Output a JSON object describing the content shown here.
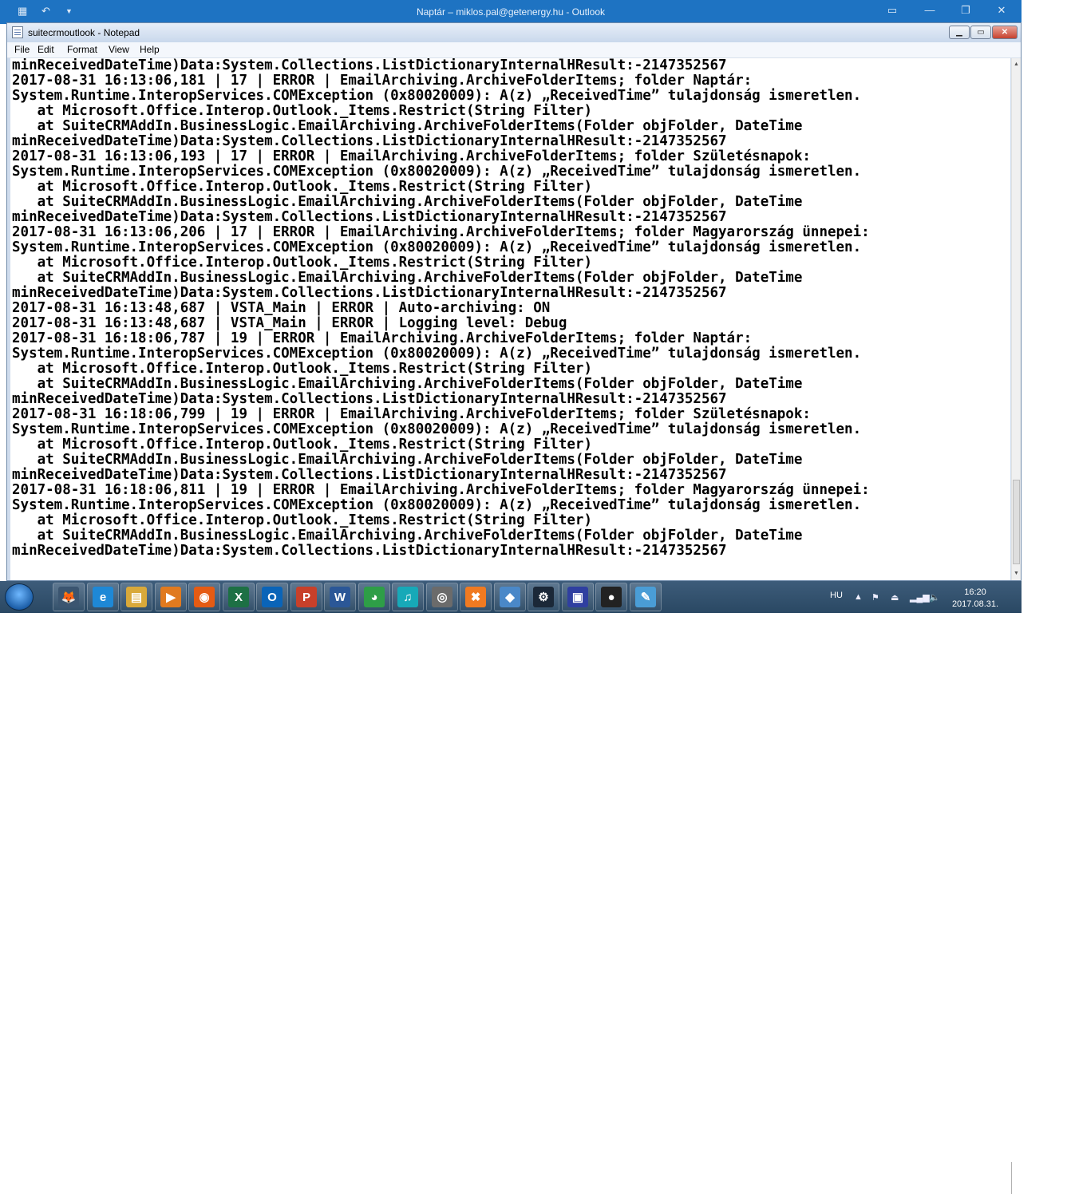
{
  "outlook": {
    "title": "Naptár – miklos.pal@getenergy.hu  -  Outlook"
  },
  "notepad": {
    "title": "suitecrmoutlook - Notepad",
    "menu": [
      "File",
      "Edit",
      "Format",
      "View",
      "Help"
    ],
    "lines": [
      "minReceivedDateTime)Data:System.Collections.ListDictionaryInternalHResult:-2147352567",
      "2017-08-31 16:13:06,181 | 17 | ERROR | EmailArchiving.ArchiveFolderItems; folder Naptár:",
      "System.Runtime.InteropServices.COMException (0x80020009): A(z) „ReceivedTime” tulajdonság ismeretlen.",
      "   at Microsoft.Office.Interop.Outlook._Items.Restrict(String Filter)",
      "   at SuiteCRMAddIn.BusinessLogic.EmailArchiving.ArchiveFolderItems(Folder objFolder, DateTime",
      "minReceivedDateTime)Data:System.Collections.ListDictionaryInternalHResult:-2147352567",
      "2017-08-31 16:13:06,193 | 17 | ERROR | EmailArchiving.ArchiveFolderItems; folder Születésnapok:",
      "System.Runtime.InteropServices.COMException (0x80020009): A(z) „ReceivedTime” tulajdonság ismeretlen.",
      "   at Microsoft.Office.Interop.Outlook._Items.Restrict(String Filter)",
      "   at SuiteCRMAddIn.BusinessLogic.EmailArchiving.ArchiveFolderItems(Folder objFolder, DateTime",
      "minReceivedDateTime)Data:System.Collections.ListDictionaryInternalHResult:-2147352567",
      "2017-08-31 16:13:06,206 | 17 | ERROR | EmailArchiving.ArchiveFolderItems; folder Magyarország ünnepei:",
      "System.Runtime.InteropServices.COMException (0x80020009): A(z) „ReceivedTime” tulajdonság ismeretlen.",
      "   at Microsoft.Office.Interop.Outlook._Items.Restrict(String Filter)",
      "   at SuiteCRMAddIn.BusinessLogic.EmailArchiving.ArchiveFolderItems(Folder objFolder, DateTime",
      "minReceivedDateTime)Data:System.Collections.ListDictionaryInternalHResult:-2147352567",
      "2017-08-31 16:13:48,687 | VSTA_Main | ERROR | Auto-archiving: ON",
      "2017-08-31 16:13:48,687 | VSTA_Main | ERROR | Logging level: Debug",
      "2017-08-31 16:18:06,787 | 19 | ERROR | EmailArchiving.ArchiveFolderItems; folder Naptár:",
      "System.Runtime.InteropServices.COMException (0x80020009): A(z) „ReceivedTime” tulajdonság ismeretlen.",
      "   at Microsoft.Office.Interop.Outlook._Items.Restrict(String Filter)",
      "   at SuiteCRMAddIn.BusinessLogic.EmailArchiving.ArchiveFolderItems(Folder objFolder, DateTime",
      "minReceivedDateTime)Data:System.Collections.ListDictionaryInternalHResult:-2147352567",
      "2017-08-31 16:18:06,799 | 19 | ERROR | EmailArchiving.ArchiveFolderItems; folder Születésnapok:",
      "System.Runtime.InteropServices.COMException (0x80020009): A(z) „ReceivedTime” tulajdonság ismeretlen.",
      "   at Microsoft.Office.Interop.Outlook._Items.Restrict(String Filter)",
      "   at SuiteCRMAddIn.BusinessLogic.EmailArchiving.ArchiveFolderItems(Folder objFolder, DateTime",
      "minReceivedDateTime)Data:System.Collections.ListDictionaryInternalHResult:-2147352567",
      "2017-08-31 16:18:06,811 | 19 | ERROR | EmailArchiving.ArchiveFolderItems; folder Magyarország ünnepei:",
      "System.Runtime.InteropServices.COMException (0x80020009): A(z) „ReceivedTime” tulajdonság ismeretlen.",
      "   at Microsoft.Office.Interop.Outlook._Items.Restrict(String Filter)",
      "   at SuiteCRMAddIn.BusinessLogic.EmailArchiving.ArchiveFolderItems(Folder objFolder, DateTime",
      "minReceivedDateTime)Data:System.Collections.ListDictionaryInternalHResult:-2147352567"
    ]
  },
  "taskbar": {
    "apps": [
      {
        "name": "fox-app-icon",
        "glyph": "🦊",
        "color": "#3b5570"
      },
      {
        "name": "internet-explorer-icon",
        "glyph": "e",
        "color": "#1e88d6"
      },
      {
        "name": "file-explorer-icon",
        "glyph": "▤",
        "color": "#d9a93a"
      },
      {
        "name": "media-player-icon",
        "glyph": "▶",
        "color": "#e07a1f"
      },
      {
        "name": "firefox-icon",
        "glyph": "◉",
        "color": "#e55b13"
      },
      {
        "name": "excel-icon",
        "glyph": "X",
        "color": "#1d7044"
      },
      {
        "name": "outlook-icon",
        "glyph": "O",
        "color": "#0a64b8"
      },
      {
        "name": "powerpoint-icon",
        "glyph": "P",
        "color": "#c8402a"
      },
      {
        "name": "word-icon",
        "glyph": "W",
        "color": "#2b5797"
      },
      {
        "name": "chrome-icon",
        "glyph": "◕",
        "color": "#2e9e47"
      },
      {
        "name": "headphones-icon",
        "glyph": "♫",
        "color": "#17a9b8"
      },
      {
        "name": "camera-icon",
        "glyph": "◎",
        "color": "#6b6b6b"
      },
      {
        "name": "xampp-icon",
        "glyph": "✖",
        "color": "#f07a21"
      },
      {
        "name": "virtualbox-icon",
        "glyph": "◆",
        "color": "#4a88c8"
      },
      {
        "name": "steam-icon",
        "glyph": "⚙",
        "color": "#1b2838"
      },
      {
        "name": "save-disk-icon",
        "glyph": "▣",
        "color": "#2f3fa0"
      },
      {
        "name": "media-app-icon",
        "glyph": "●",
        "color": "#222222"
      },
      {
        "name": "notepad-icon",
        "glyph": "✎",
        "color": "#4a9dd6"
      }
    ],
    "tray": {
      "language": "HU",
      "time": "16:20",
      "date": "2017.08.31."
    }
  }
}
